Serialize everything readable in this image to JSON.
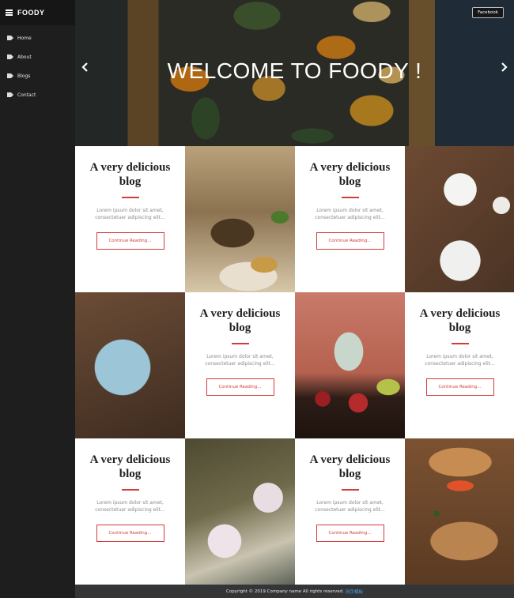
{
  "brand": {
    "name": "FOODY"
  },
  "nav": [
    {
      "label": "Home"
    },
    {
      "label": "About"
    },
    {
      "label": "Blogs"
    },
    {
      "label": "Contact"
    }
  ],
  "hero": {
    "title": "WELCOME TO FOODY !",
    "facebook_label": "Facebook"
  },
  "cards": {
    "title": "A very delicious blog",
    "text": "Lorem ipsum dolor sit amet, consectetuer adipiscing elit...",
    "button": "Continue Reading..."
  },
  "footer": {
    "copyright": "Copyright © 2019.Company name All rights reserved.",
    "credit": "网页模板"
  },
  "colors": {
    "sidebar": "#1e1e1e",
    "accent": "#d23c3c",
    "footer": "#333537"
  },
  "icons": {
    "menu": "hamburger-icon",
    "nav_item": "tag-icon",
    "prev": "chevron-left-icon",
    "next": "chevron-right-icon"
  }
}
